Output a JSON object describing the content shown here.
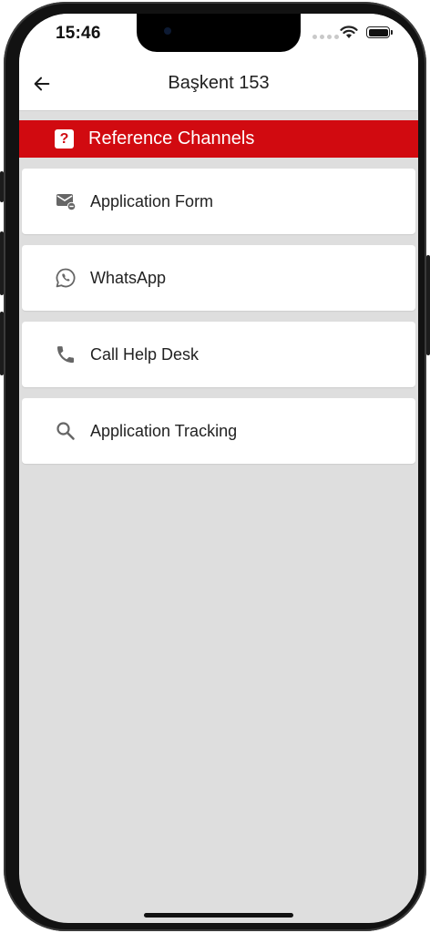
{
  "status_bar": {
    "time": "15:46"
  },
  "app_bar": {
    "title": "Başkent 153",
    "back_icon": "arrow-left-icon"
  },
  "banner": {
    "icon": "question-box-icon",
    "icon_glyph": "?",
    "title": "Reference Channels"
  },
  "menu_items": [
    {
      "label": "Application Form",
      "icon": "email-minus-icon"
    },
    {
      "label": "WhatsApp",
      "icon": "whatsapp-icon"
    },
    {
      "label": "Call Help Desk",
      "icon": "phone-icon"
    },
    {
      "label": "Application Tracking",
      "icon": "search-icon"
    }
  ],
  "colors": {
    "banner": "#d10a10",
    "background": "#dedede",
    "card": "#ffffff",
    "icon": "#666666"
  }
}
